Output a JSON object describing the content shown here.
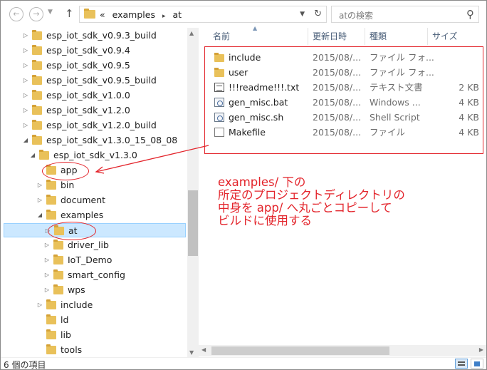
{
  "address_bar": {
    "crumbs": [
      "«",
      "examples",
      "▸",
      "at"
    ],
    "search_placeholder": "atの検索"
  },
  "tree": {
    "items": [
      {
        "label": "esp_iot_sdk_v0.9.3_build",
        "expander": "▷"
      },
      {
        "label": "esp_iot_sdk_v0.9.4",
        "expander": "▷"
      },
      {
        "label": "esp_iot_sdk_v0.9.5",
        "expander": "▷"
      },
      {
        "label": "esp_iot_sdk_v0.9.5_build",
        "expander": "▷"
      },
      {
        "label": "esp_iot_sdk_v1.0.0",
        "expander": "▷"
      },
      {
        "label": "esp_iot_sdk_v1.2.0",
        "expander": "▷"
      },
      {
        "label": "esp_iot_sdk_v1.2.0_build",
        "expander": "▷"
      },
      {
        "label": "esp_iot_sdk_v1.3.0_15_08_08",
        "expander": "◢"
      },
      {
        "label": "esp_iot_sdk_v1.3.0",
        "expander": "◢"
      },
      {
        "label": "app",
        "expander": ""
      },
      {
        "label": "bin",
        "expander": "▷"
      },
      {
        "label": "document",
        "expander": "▷"
      },
      {
        "label": "examples",
        "expander": "◢"
      },
      {
        "label": "at",
        "expander": "▷"
      },
      {
        "label": "driver_lib",
        "expander": "▷"
      },
      {
        "label": "IoT_Demo",
        "expander": "▷"
      },
      {
        "label": "smart_config",
        "expander": "▷"
      },
      {
        "label": "wps",
        "expander": "▷"
      },
      {
        "label": "include",
        "expander": "▷"
      },
      {
        "label": "ld",
        "expander": ""
      },
      {
        "label": "lib",
        "expander": ""
      },
      {
        "label": "tools",
        "expander": ""
      }
    ]
  },
  "list": {
    "columns": {
      "name": "名前",
      "date": "更新日時",
      "type": "種類",
      "size": "サイズ"
    },
    "rows": [
      {
        "name": "include",
        "date": "2015/08/...",
        "type": "ファイル フォ...",
        "size": "",
        "icon": "folder-icon"
      },
      {
        "name": "user",
        "date": "2015/08/...",
        "type": "ファイル フォ...",
        "size": "",
        "icon": "folder-icon"
      },
      {
        "name": "!!!readme!!!.txt",
        "date": "2015/08/...",
        "type": "テキスト文書",
        "size": "2 KB",
        "icon": "text-file-icon"
      },
      {
        "name": "gen_misc.bat",
        "date": "2015/08/...",
        "type": "Windows ...",
        "size": "4 KB",
        "icon": "batch-file-icon"
      },
      {
        "name": "gen_misc.sh",
        "date": "2015/08/...",
        "type": "Shell Script",
        "size": "4 KB",
        "icon": "script-file-icon"
      },
      {
        "name": "Makefile",
        "date": "2015/08/...",
        "type": "ファイル",
        "size": "4 KB",
        "icon": "blank-file-icon"
      }
    ]
  },
  "status": {
    "item_count": "6 個の項目"
  },
  "annotation": {
    "lines": [
      "examples/ 下の",
      "所定のプロジェクトディレクトリの",
      "中身を app/ へ丸ごとコピーして",
      "ビルドに使用する"
    ],
    "color": "#e3242b"
  }
}
